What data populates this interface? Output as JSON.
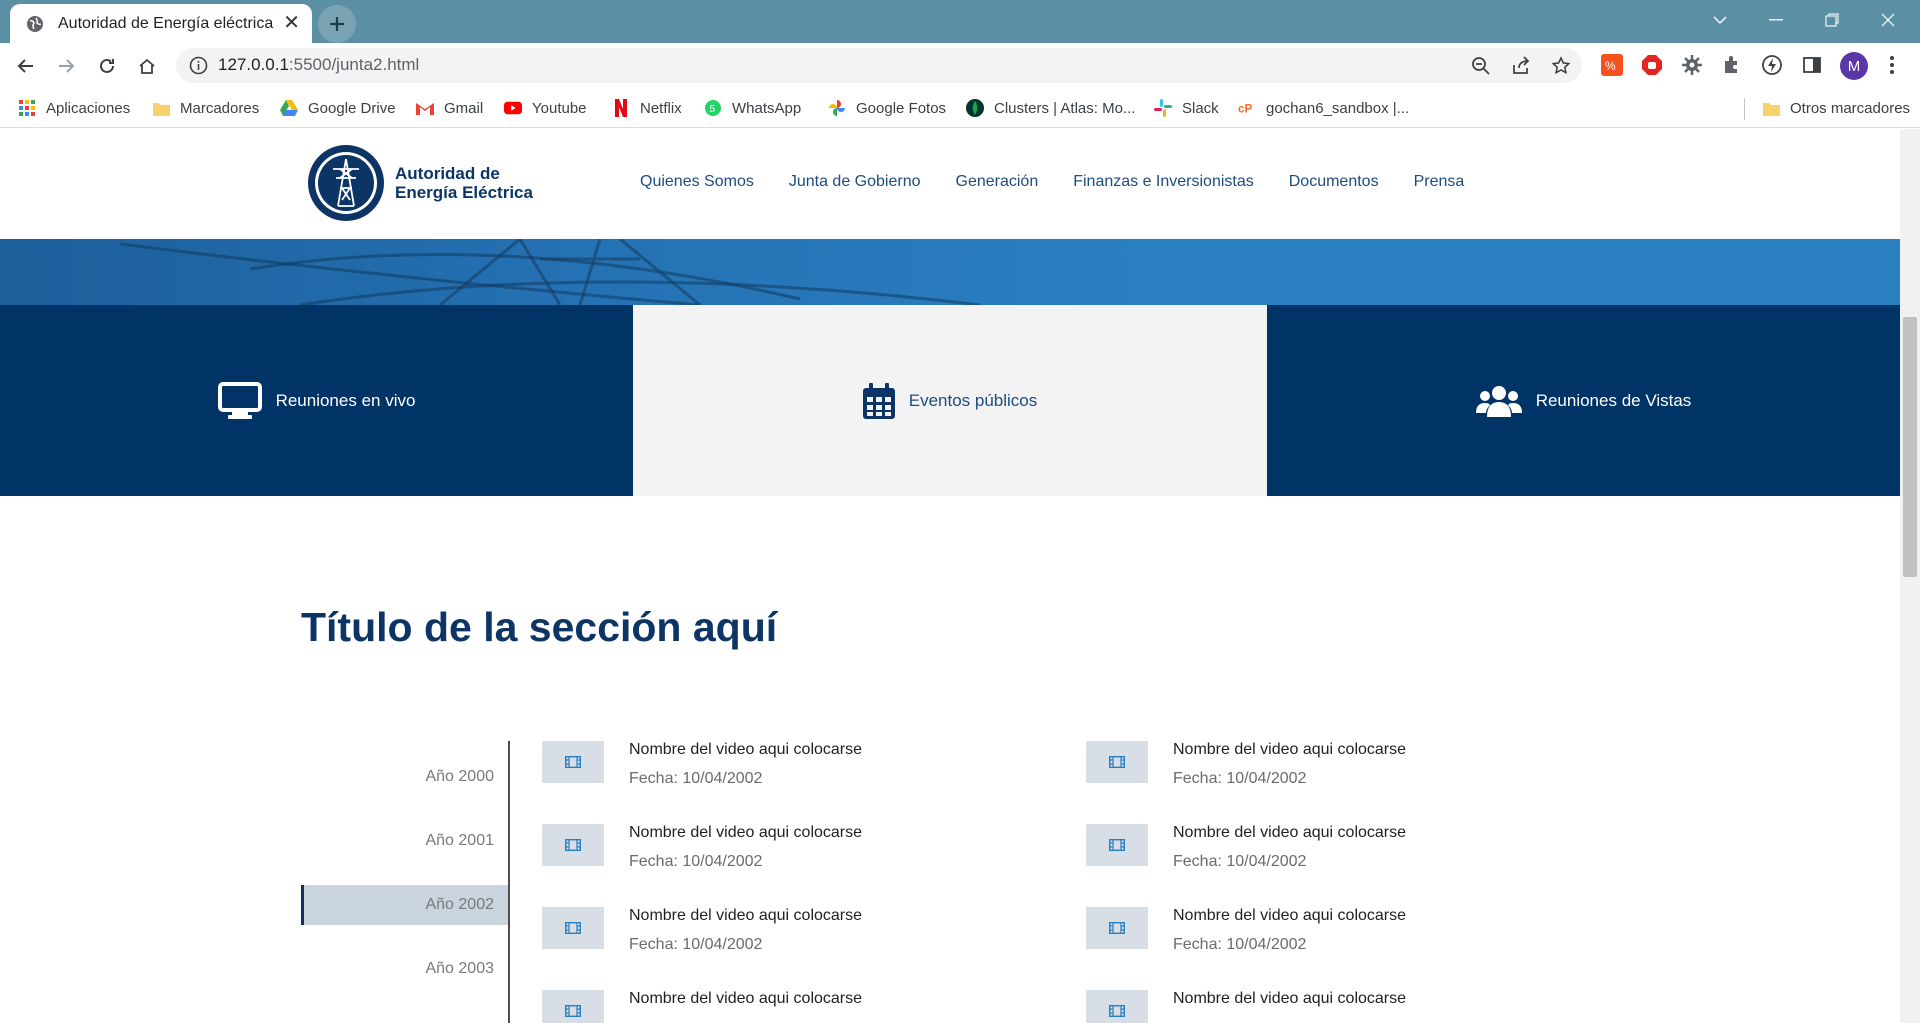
{
  "browser": {
    "tab_title": "Autoridad de Energía eléctrica",
    "url_host": "127.0.0.1",
    "url_path": ":5500/junta2.html",
    "avatar_letter": "M",
    "bookmarks": [
      {
        "label": "Aplicaciones",
        "icon": "apps-grid-icon"
      },
      {
        "label": "Marcadores",
        "icon": "folder-icon"
      },
      {
        "label": "Google Drive",
        "icon": "google-drive-icon"
      },
      {
        "label": "Gmail",
        "icon": "gmail-icon"
      },
      {
        "label": "Youtube",
        "icon": "youtube-icon"
      },
      {
        "label": "Netflix",
        "icon": "netflix-icon"
      },
      {
        "label": "WhatsApp",
        "icon": "whatsapp-icon"
      },
      {
        "label": "Google Fotos",
        "icon": "google-photos-icon"
      },
      {
        "label": "Clusters | Atlas: Mo...",
        "icon": "mongodb-leaf-icon"
      },
      {
        "label": "Slack",
        "icon": "slack-icon"
      },
      {
        "label": "gochan6_sandbox |...",
        "icon": "cpanel-icon"
      }
    ],
    "other_bookmarks": "Otros marcadores"
  },
  "site": {
    "logo_line1": "Autoridad de",
    "logo_line2": "Energía Eléctrica",
    "nav": [
      "Quienes Somos",
      "Junta de Gobierno",
      "Generación",
      "Finanzas e Inversionistas",
      "Documentos",
      "Prensa"
    ],
    "tabs": [
      {
        "label": "Reuniones en vivo",
        "icon": "monitor-icon"
      },
      {
        "label": "Eventos públicos",
        "icon": "calendar-icon"
      },
      {
        "label": "Reuniones de Vistas",
        "icon": "users-icon"
      }
    ],
    "section_title": "Título de la sección aquí",
    "years": [
      "Año 2000",
      "Año 2001",
      "Año 2002",
      "Año 2003"
    ],
    "active_year": "Año 2002",
    "videos": [
      {
        "name": "Nombre del video aqui colocarse",
        "date": "Fecha: 10/04/2002"
      },
      {
        "name": "Nombre del video aqui colocarse",
        "date": "Fecha: 10/04/2002"
      },
      {
        "name": "Nombre del video aqui colocarse",
        "date": "Fecha: 10/04/2002"
      },
      {
        "name": "Nombre del video aqui colocarse",
        "date": "Fecha: 10/04/2002"
      },
      {
        "name": "Nombre del video aqui colocarse",
        "date": "Fecha: 10/04/2002"
      },
      {
        "name": "Nombre del video aqui colocarse",
        "date": "Fecha: 10/04/2002"
      },
      {
        "name": "Nombre del video aqui colocarse",
        "date": ""
      },
      {
        "name": "Nombre del video aqui colocarse",
        "date": ""
      }
    ],
    "colors": {
      "primary": "#003366",
      "accent": "#2a7fc1",
      "tab_light": "#f3f3f3",
      "text_dark": "#0c3566"
    }
  }
}
